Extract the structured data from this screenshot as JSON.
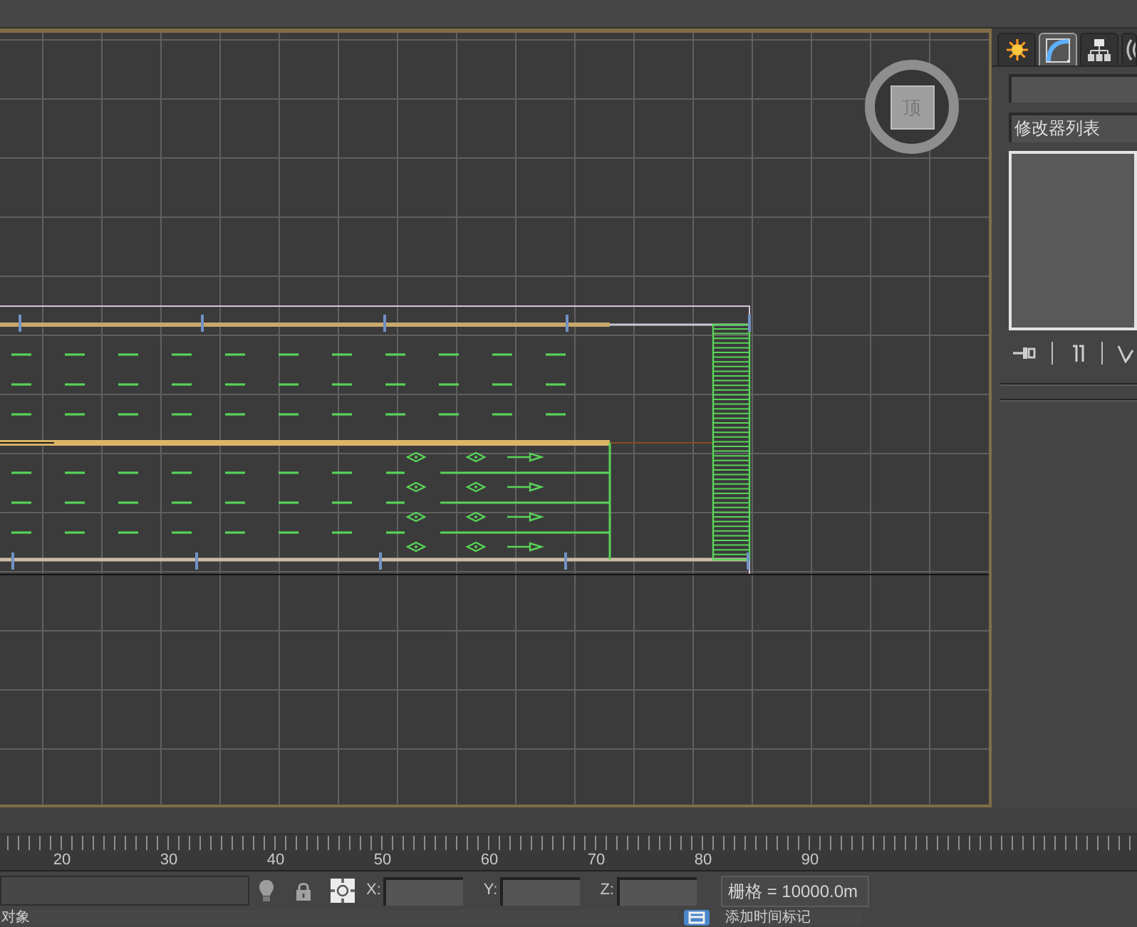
{
  "viewport": {
    "viewcube": {
      "face": "顶"
    }
  },
  "command_panel": {
    "tabs": [
      {
        "kind": "create",
        "selected": false
      },
      {
        "kind": "modify",
        "selected": true
      },
      {
        "kind": "hierarchy",
        "selected": false
      },
      {
        "kind": "motion",
        "selected": false
      }
    ],
    "modifier_list": "修改器列表"
  },
  "track_bar": {
    "frame_labels": [
      "20",
      "30",
      "40",
      "50",
      "60",
      "70",
      "80",
      "90"
    ]
  },
  "status_bar": {
    "coordinates": [
      {
        "axis": "X:"
      },
      {
        "axis": "Y:"
      },
      {
        "axis": "Z:"
      }
    ],
    "grid": "栅格 = 10000.0m",
    "prompt": "对象",
    "time_tag": "添加时间标记"
  }
}
